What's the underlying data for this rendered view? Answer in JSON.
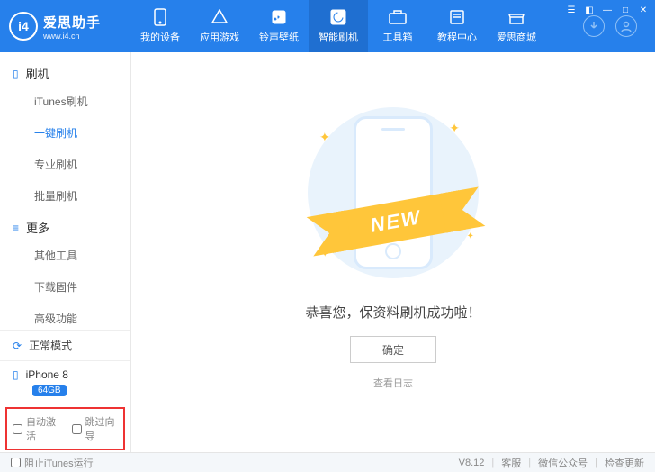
{
  "brand": {
    "logo": "i4",
    "title": "爱思助手",
    "sub": "www.i4.cn"
  },
  "nav": [
    {
      "label": "我的设备",
      "icon": "phone"
    },
    {
      "label": "应用游戏",
      "icon": "apps"
    },
    {
      "label": "铃声壁纸",
      "icon": "note"
    },
    {
      "label": "智能刷机",
      "icon": "flash",
      "active": true
    },
    {
      "label": "工具箱",
      "icon": "toolbox"
    },
    {
      "label": "教程中心",
      "icon": "book"
    },
    {
      "label": "爱思商城",
      "icon": "shop"
    }
  ],
  "sidebar": {
    "group1": {
      "title": "刷机",
      "items": [
        "iTunes刷机",
        "一键刷机",
        "专业刷机",
        "批量刷机"
      ],
      "active": 1
    },
    "group2": {
      "title": "更多",
      "items": [
        "其他工具",
        "下载固件",
        "高级功能"
      ]
    }
  },
  "mode": {
    "label": "正常模式"
  },
  "device": {
    "name": "iPhone 8",
    "storage": "64GB"
  },
  "redbox": {
    "opt1": "自动激活",
    "opt2": "跳过向导"
  },
  "main": {
    "ribbon": "NEW",
    "message": "恭喜您，保资料刷机成功啦！",
    "ok": "确定",
    "log": "查看日志"
  },
  "footer": {
    "block_itunes": "阻止iTunes运行",
    "version": "V8.12",
    "links": [
      "客服",
      "微信公众号",
      "检查更新"
    ]
  }
}
